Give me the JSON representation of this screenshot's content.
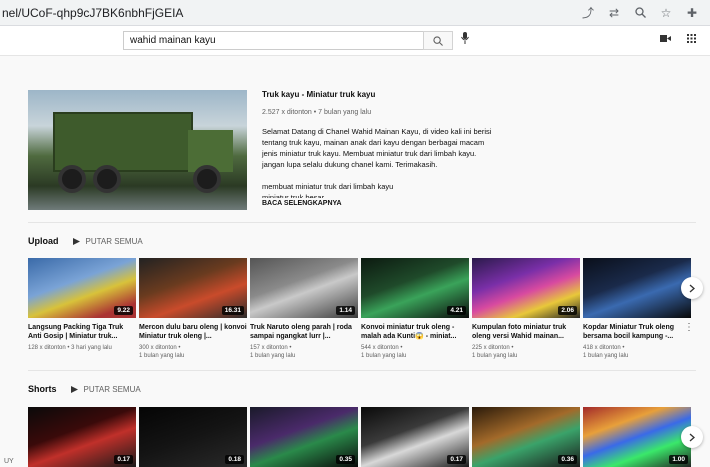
{
  "browser": {
    "url": "nel/UCoF-qhp9cJ7BK6nbhFjGEIA",
    "icons": [
      "share-icon",
      "translate-icon",
      "zoom-icon",
      "star-icon",
      "extension-icon"
    ]
  },
  "header": {
    "search_value": "wahid mainan kayu",
    "right_icons": [
      "create-video-icon",
      "apps-grid-icon"
    ]
  },
  "featured": {
    "title": "Truk kayu - Miniatur truk kayu",
    "meta": "2.527 x ditonton • 7 bulan yang lalu",
    "desc1": "Selamat Datang di Chanel Wahid Mainan Kayu, di video kali ini berisi tentang truk kayu, mainan anak dari kayu dengan berbagai macam jenis miniatur truk kayu. Membuat miniatur truk dari limbah kayu. jangan lupa selalu dukung chanel kami. Terimakasih.",
    "desc2": "membuat miniatur truk dari limbah kayu",
    "desc3": "miniatur truk besar",
    "read_more": "BACA SELENGKAPNYA"
  },
  "upload_shelf": {
    "title": "Upload",
    "play_all": "PUTAR SEMUA",
    "videos": [
      {
        "title": "Langsung Packing Tiga Truk Anti Gosip | Miniatur truk...",
        "meta1": "128 x ditonton • 3 hari yang lalu",
        "meta2": "",
        "duration": "9.22",
        "bg": "linear-gradient(160deg,#3a6aa8,#7aa3d6 40%,#d8c23a 60%,#a33 85%)"
      },
      {
        "title": "Mercon dulu baru oleng | konvoi Miniatur truk oleng |...",
        "meta1": "300 x ditonton •",
        "meta2": "1 bulan yang lalu",
        "duration": "16.31",
        "bg": "linear-gradient(160deg,#222,#6a3b1f 40%,#c94b2b 65%,#2b2b2b)"
      },
      {
        "title": "Truk Naruto oleng parah | roda sampai ngangkat lurr |...",
        "meta1": "157 x ditonton •",
        "meta2": "1 bulan yang lalu",
        "duration": "1.14",
        "bg": "linear-gradient(160deg,#555,#8a8a8a 40%,#c9c9c9 55%,#3a3a3a)"
      },
      {
        "title": "Konvoi miniatur truk oleng - malah ada Kunti😱 - miniat...",
        "meta1": "544 x ditonton •",
        "meta2": "1 bulan yang lalu",
        "duration": "4.21",
        "bg": "linear-gradient(160deg,#0c1a10,#1f4a2a 40%,#3aa35a 60%,#0a0a0a)"
      },
      {
        "title": "Kumpulan foto miniatur truk oleng versi Wahid mainan...",
        "meta1": "225 x ditonton •",
        "meta2": "1 bulan yang lalu",
        "duration": "2.06",
        "bg": "linear-gradient(160deg,#2a1a4a,#7a2fa8 35%,#d84aa0 55%,#e8c83a 75%,#222)"
      },
      {
        "title": "Kopdar Miniatur Truk oleng bersama bocil kampung -...",
        "meta1": "418 x ditonton •",
        "meta2": "1 bulan yang lalu",
        "duration": "",
        "bg": "linear-gradient(160deg,#0a0f1a,#1a2a4a 40%,#3a6ab0 60%,#080808)"
      }
    ]
  },
  "shorts_shelf": {
    "title": "Shorts",
    "play_all": "PUTAR SEMUA",
    "items": [
      {
        "duration": "0.17",
        "bg": "linear-gradient(160deg,#0a0a0a,#3a0a0a 40%,#c0302a 60%,#1a1a1a)"
      },
      {
        "duration": "0.18",
        "bg": "linear-gradient(160deg,#050505,#141414 50%,#2a2a2a)"
      },
      {
        "duration": "0.35",
        "bg": "linear-gradient(160deg,#1a1a2a,#4a2a6a 40%,#2a8a4a 60%,#0a0a0a)"
      },
      {
        "duration": "0.17",
        "bg": "linear-gradient(160deg,#0a0a0a,#3a3a3a 40%,#d8d8d8 60%,#1a1a1a)"
      },
      {
        "duration": "0.36",
        "bg": "linear-gradient(160deg,#2a1a0a,#a36a2a 40%,#3aa36a 60%,#1a1a1a)"
      },
      {
        "duration": "1.00",
        "bg": "linear-gradient(160deg,#a32a2a,#e8a03a 30%,#3a6ae8 50%,#3ae86a 70%,#222)"
      }
    ]
  },
  "corner_text": "UY"
}
